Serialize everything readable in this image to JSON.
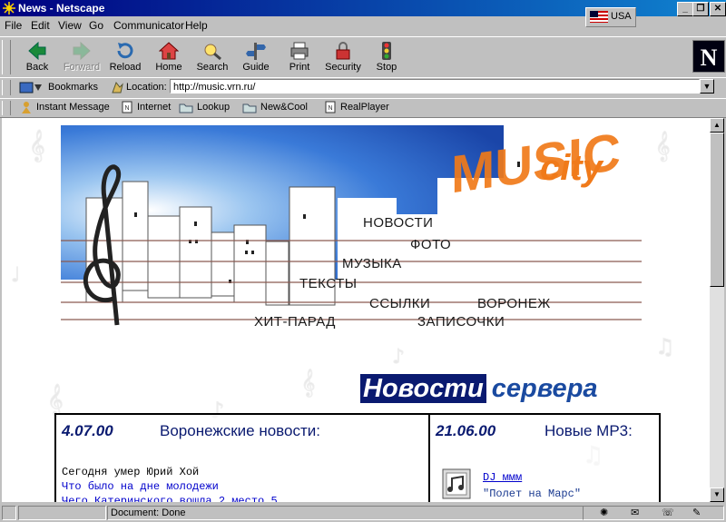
{
  "window": {
    "title": "News - Netscape",
    "locale": "USA"
  },
  "menu": [
    "File",
    "Edit",
    "View",
    "Go",
    "Communicator",
    "Help"
  ],
  "toolbar": {
    "back": "Back",
    "forward": "Forward",
    "reload": "Reload",
    "home": "Home",
    "search": "Search",
    "guide": "Guide",
    "print": "Print",
    "security": "Security",
    "stop": "Stop"
  },
  "location": {
    "bookmarks": "Bookmarks",
    "label": "Location:",
    "url": "http://music.vrn.ru/"
  },
  "personal": [
    "Instant Message",
    "Internet",
    "Lookup",
    "New&Cool",
    "RealPlayer"
  ],
  "banner": {
    "logo_top": "city",
    "logo_main": "MUSIC",
    "menu": [
      "НОВОСТИ",
      "ФОТО",
      "МУЗЫКА",
      "ТЕКСТЫ",
      "ССЫЛКИ",
      "ВОРОНЕЖ",
      "ХИТ-ПАРАД",
      "ЗАПИСОЧКИ"
    ]
  },
  "news_heading": {
    "part1": "Новости",
    "part2": "сервера"
  },
  "news": {
    "date": "4.07.00",
    "title": "Воронежские новости:",
    "lines": [
      "Сегодня умер Юрий Хой",
      "Что было на дне молодежи",
      "Чего Катеринского вошла 2 место 5"
    ]
  },
  "mp3": {
    "date": "21.06.00",
    "title": "Новые МР3:",
    "artist": "DJ ммм",
    "track": "\"Полет на Марс\""
  },
  "status": {
    "text": "Document: Done"
  },
  "colors": {
    "titlebar": "#000080",
    "sky": "#1e5bbf",
    "logo": "#f07a1a",
    "news_dark": "#0a1a70"
  }
}
